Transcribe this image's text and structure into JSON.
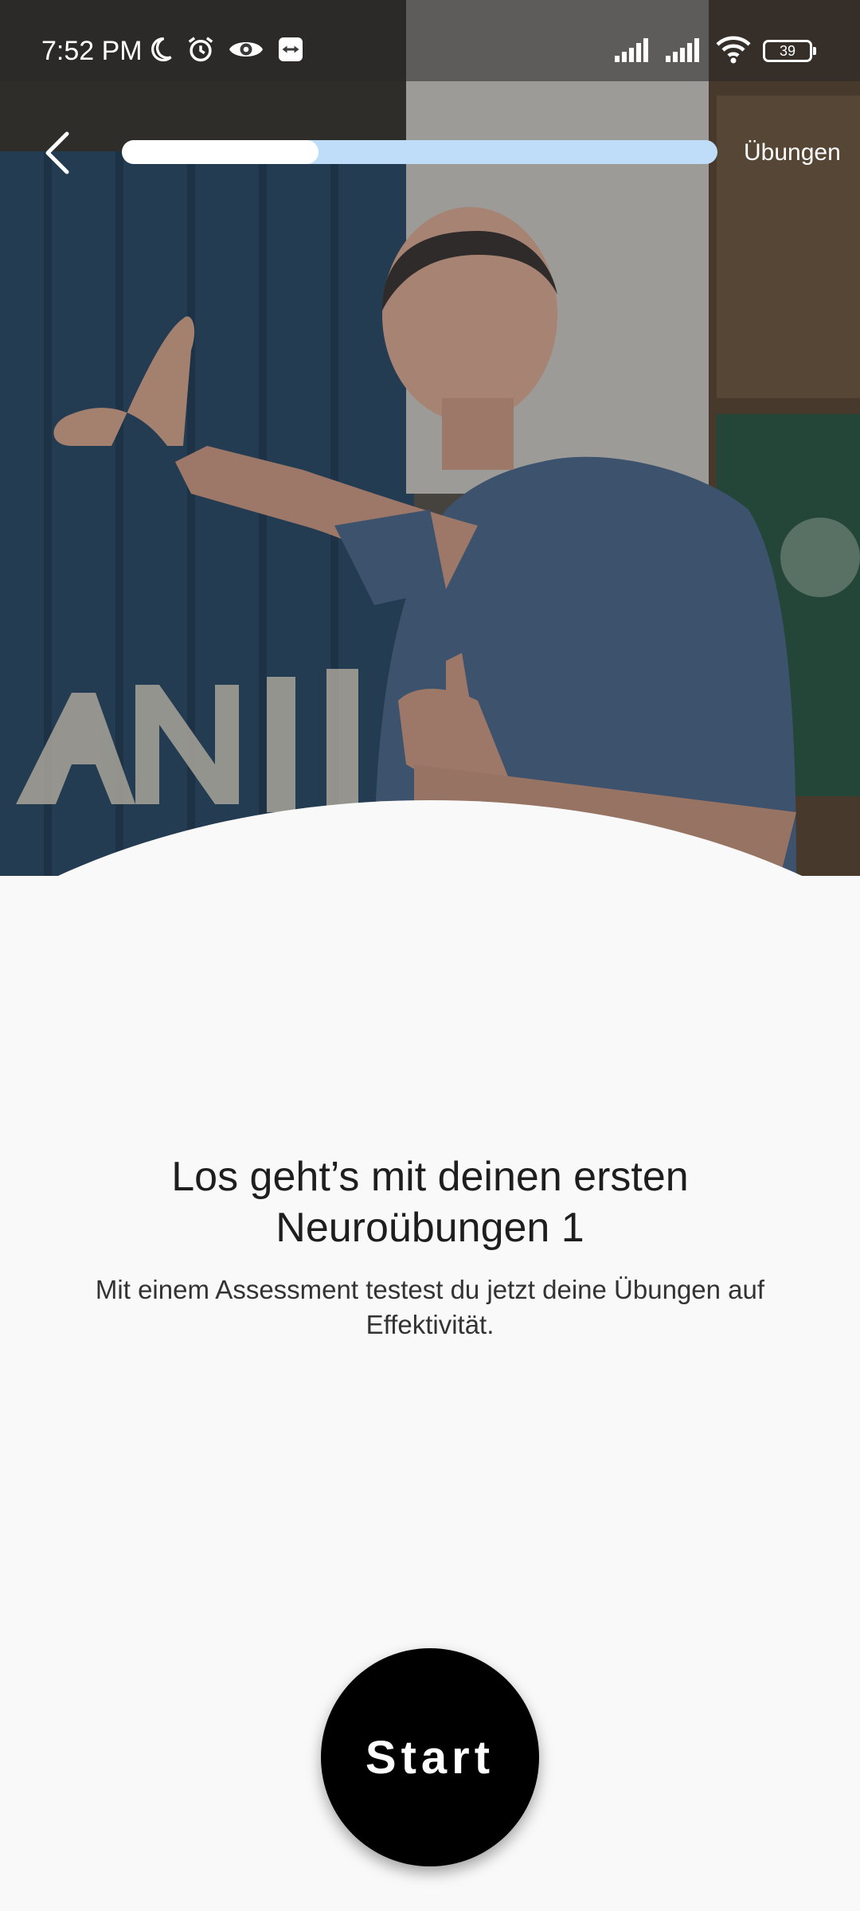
{
  "status_bar": {
    "time": "7:52 PM",
    "battery_level": "39",
    "icons_left": [
      "moon-icon",
      "alarm-icon",
      "eye-icon",
      "teamviewer-icon"
    ],
    "icons_right": [
      "signal-bars-icon",
      "signal-bars-icon",
      "wifi-icon",
      "battery-icon"
    ]
  },
  "header": {
    "progress_fraction": 0.33,
    "progress_label": "Übungen"
  },
  "main": {
    "title": "Los geht’s mit deinen ersten Neuroübungen 1",
    "description": "Mit einem Assessment testest du jetzt deine Übungen auf Effektivität.",
    "start_label": "Start"
  },
  "colors": {
    "background": "#f9f9f9",
    "progress_track": "#bfdcf8",
    "progress_fill": "#ffffff",
    "button": "#000000"
  }
}
